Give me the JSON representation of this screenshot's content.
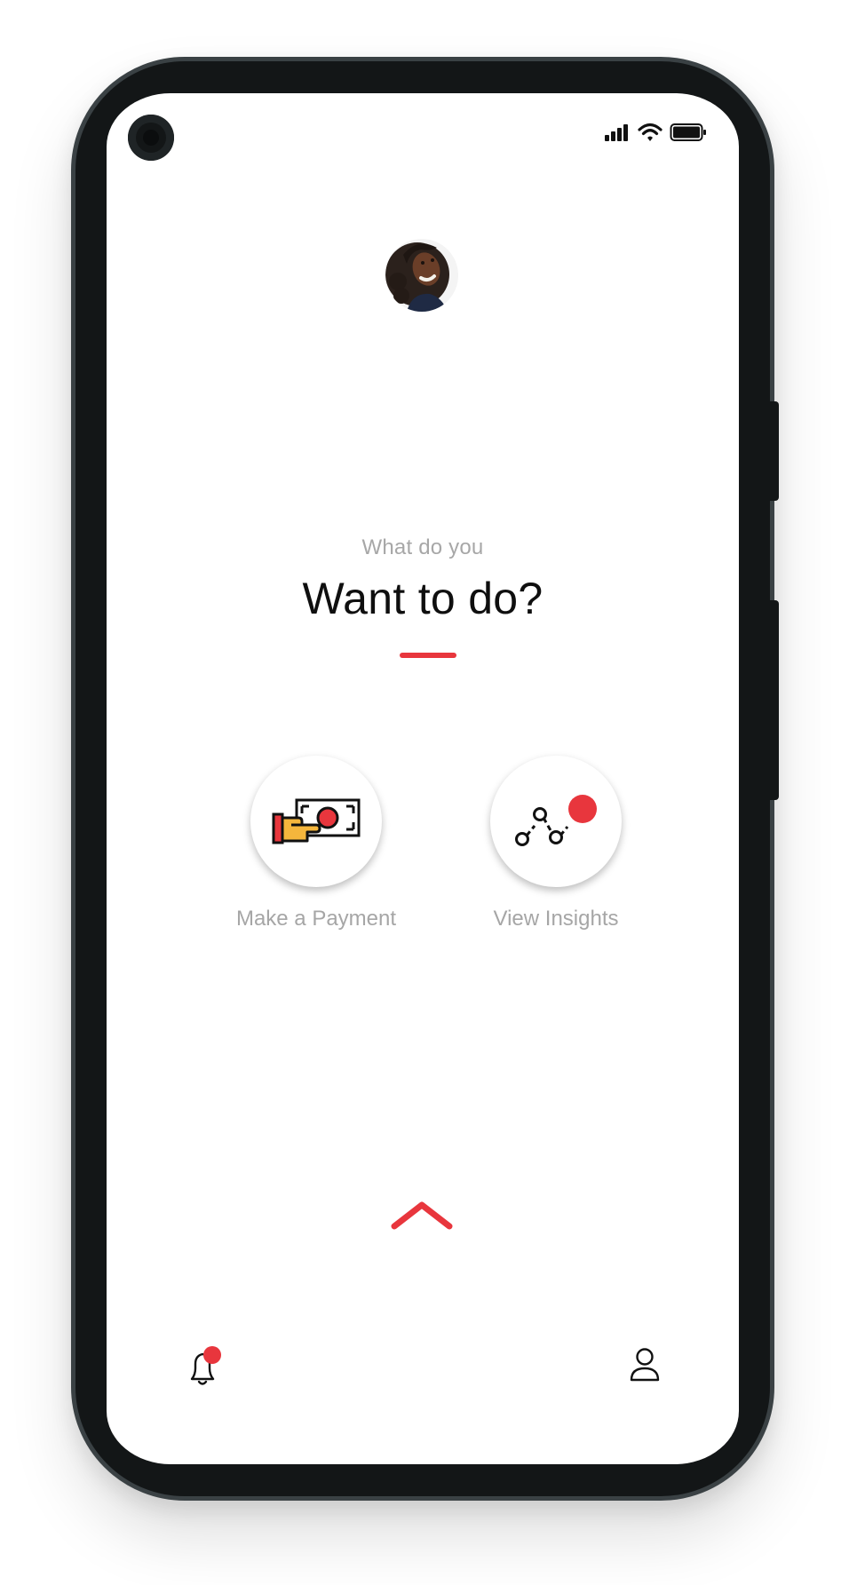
{
  "colors": {
    "accent": "#e8363d",
    "frame": "#131617",
    "muted_text": "#a7a7a7",
    "title_text": "#0f0f0f"
  },
  "status_bar": {
    "icons": [
      "signal-icon",
      "wifi-icon",
      "battery-icon"
    ]
  },
  "header": {
    "avatar": "profile-photo"
  },
  "prompt": {
    "subtitle": "What do you",
    "title": "Want to do?"
  },
  "actions": [
    {
      "label": "Make a Payment",
      "icon": "hand-money-icon"
    },
    {
      "label": "View Insights",
      "icon": "graph-nodes-icon",
      "badge": true
    }
  ],
  "expand": {
    "icon": "chevron-up-icon"
  },
  "bottom_nav": [
    {
      "icon": "bell-icon",
      "badge": true
    },
    {
      "icon": "user-icon"
    }
  ]
}
